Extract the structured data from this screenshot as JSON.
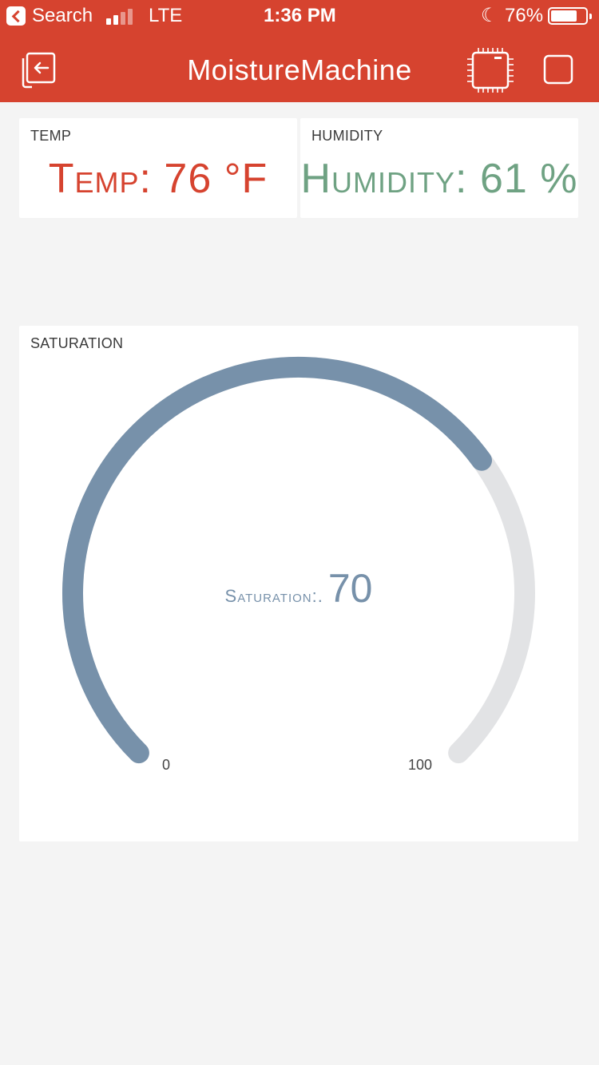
{
  "status_bar": {
    "back_app": "Search",
    "carrier": "LTE",
    "time": "1:36 PM",
    "battery": "76%",
    "battery_level": 0.76
  },
  "nav": {
    "title": "MoistureMachine",
    "left_icon": "exit-icon",
    "right_icons": [
      "chip-icon",
      "square-icon"
    ]
  },
  "widgets": {
    "temp": {
      "label": "TEMP",
      "prefix": "Temp:",
      "value": "76",
      "unit": "°F",
      "color": "#d6432f"
    },
    "humidity": {
      "label": "HUMIDITY",
      "prefix": "Humidity:",
      "value": "61",
      "unit": "%",
      "color": "#6fa283"
    },
    "saturation": {
      "label": "SATURATION",
      "center_label": "Saturation:.",
      "value": 70,
      "min": "0",
      "max": "100",
      "range": [
        0,
        100
      ],
      "fill_color": "#7791aa",
      "track_color": "#e2e3e5"
    }
  },
  "colors": {
    "header": "#d6432f",
    "background": "#f4f4f4"
  }
}
